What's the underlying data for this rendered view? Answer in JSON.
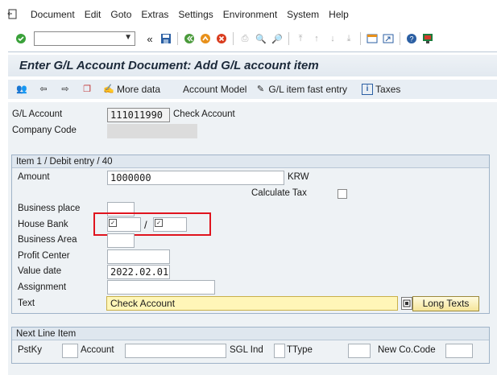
{
  "menubar": {
    "items": [
      "Document",
      "Edit",
      "Goto",
      "Extras",
      "Settings",
      "Environment",
      "System",
      "Help"
    ]
  },
  "toolbar": {
    "okcode_value": ""
  },
  "title": "Enter G/L Account Document: Add G/L account item",
  "appbar": {
    "more_data": "More data",
    "account_model": "Account Model",
    "fast_entry": "G/L item fast entry",
    "taxes": "Taxes"
  },
  "header": {
    "gl_account_label": "G/L Account",
    "gl_account_value": "111011990",
    "gl_account_desc": "Check Account",
    "company_code_label": "Company Code",
    "company_code_value": ""
  },
  "item": {
    "group_title": "Item 1 / Debit entry / 40",
    "amount_label": "Amount",
    "amount_value": "1000000",
    "currency": "KRW",
    "calc_tax_label": "Calculate Tax",
    "business_place_label": "Business place",
    "house_bank_label": "House Bank",
    "house_bank_sep": "/",
    "business_area_label": "Business Area",
    "profit_center_label": "Profit Center",
    "value_date_label": "Value date",
    "value_date_value": "2022.02.01",
    "assignment_label": "Assignment",
    "text_label": "Text",
    "text_value": "Check Account",
    "long_texts_button": "Long Texts"
  },
  "next_line": {
    "group_title": "Next Line Item",
    "pstky_label": "PstKy",
    "account_label": "Account",
    "sgl_label": "SGL Ind",
    "ttype_label": "TType",
    "newco_label": "New Co.Code"
  },
  "colors": {
    "highlight_box": "#e0141e",
    "title_bar": "#e2e9f0",
    "text_field": "#fff6b8"
  }
}
